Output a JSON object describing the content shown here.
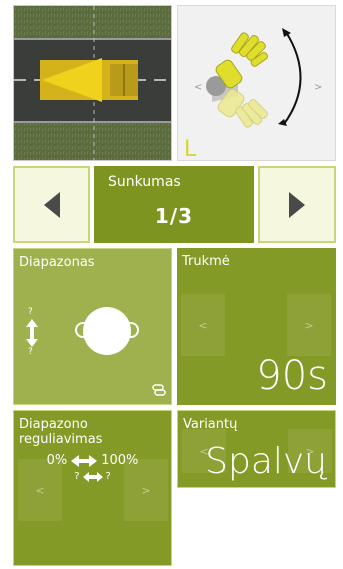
{
  "images": {
    "road": {
      "icon": "truck-on-road-image"
    },
    "hand": {
      "icon": "hand-motion-image",
      "side_letter": "L",
      "left_marker": "<",
      "right_marker": ">"
    }
  },
  "difficulty": {
    "label": "Sunkumas",
    "value": "1/3",
    "prev_icon": "triangle-left-icon",
    "next_icon": "triangle-right-icon"
  },
  "range": {
    "title": "Diapazonas",
    "question_top": "?",
    "question_bottom": "?",
    "link_icon": "chain-link-icon"
  },
  "duration": {
    "title": "Trukmė",
    "left": "<",
    "right": ">",
    "value": "90s"
  },
  "range_adjust": {
    "title": "Diapazono reguliavimas",
    "from": "0%",
    "to": "100%",
    "q_from": "?",
    "q_to": "?",
    "left": "<",
    "right": ">"
  },
  "variants": {
    "title": "Variantų",
    "left": "<",
    "right": ">",
    "value": "Spalvų"
  },
  "colors": {
    "olive": "#849a27",
    "olive_light": "#9fb14e",
    "olive_dark": "#7e9421",
    "button_bg": "#f5f7df",
    "button_border": "#c9d47c",
    "hand_yellow": "#d7d62a"
  }
}
